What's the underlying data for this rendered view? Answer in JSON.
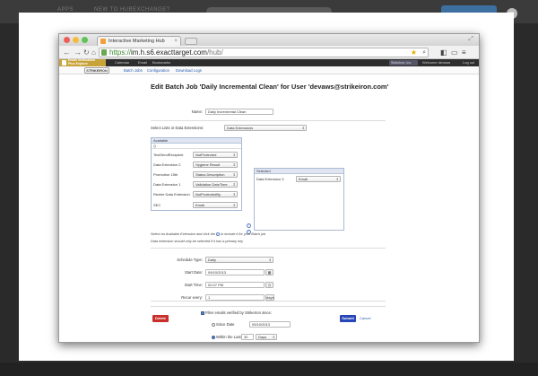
{
  "background_page": {
    "nav_left": "APPS",
    "nav_mid": "NEW TO HUBEXCHANGE?"
  },
  "browser": {
    "tab_title": "Interactive Marketing Hub",
    "url_scheme": "https://",
    "url_host": "im.h.s6.exacttarget.com",
    "url_path": "/hub/"
  },
  "appbar": {
    "brand_line1": "Email Verification",
    "brand_line2": "Plus Explore",
    "links": [
      "Calendar",
      "Email",
      "Bookmarks"
    ],
    "user_box": "StrikeIron, Inc.",
    "welcome": "Welcome  devaws",
    "logout": "Log out"
  },
  "subnav": {
    "brand": "STRIKEIRON",
    "links": [
      "Batch Jobs",
      "Configuration",
      "Download Logs"
    ]
  },
  "form": {
    "heading": "Edit Batch Job 'Daily Incremental Clean' for User 'devaws@strikeiron.com'",
    "name_label": "Name:",
    "name_value": "Daily Incremental Clean",
    "select_lists_label": "Select Lists or Data Extensions:",
    "select_lists_value": "Data Extensions",
    "available_header": "Available",
    "search_glyph": "Q",
    "available_rows": [
      {
        "name": "TestSendRecipient",
        "value": "NotProtected"
      },
      {
        "name": "Data Extension 2",
        "value": "Hygiene Result"
      },
      {
        "name": "Promotion 15th",
        "value": "Status Description"
      },
      {
        "name": "Data Extension 1",
        "value": "Validation DateTime"
      },
      {
        "name": "Rewire Data Extension",
        "value": "NotProtectedBy"
      },
      {
        "name": "SEC",
        "value": "Email"
      }
    ],
    "selected_header": "Selected",
    "selected_rows": [
      {
        "name": "Data Extension 3",
        "value": "Email"
      }
    ],
    "note1_a": "Select an Available Extension and click the",
    "note1_b": "to include it for your Batch job",
    "note2": "Data extension should only be selected if it has a primary key",
    "schedule_type_label": "Schedule Type:",
    "schedule_type_value": "Daily",
    "start_date_label": "Start Date:",
    "start_date_value": "09/10/2013",
    "start_time_label": "Start Time:",
    "start_time_value": "02:07 PM",
    "recur_label": "Recur every:",
    "recur_value": "1",
    "recur_unit": "days",
    "filter_label": "Filter emails verified by StrikeIron since:",
    "since_date_label": "Since Date",
    "since_date_value": "09/10/2013",
    "within_label": "Within the Last",
    "within_value": "30",
    "within_unit": "Days",
    "delete_label": "Delete",
    "submit_label": "Submit",
    "cancel_label": "Cancel"
  }
}
